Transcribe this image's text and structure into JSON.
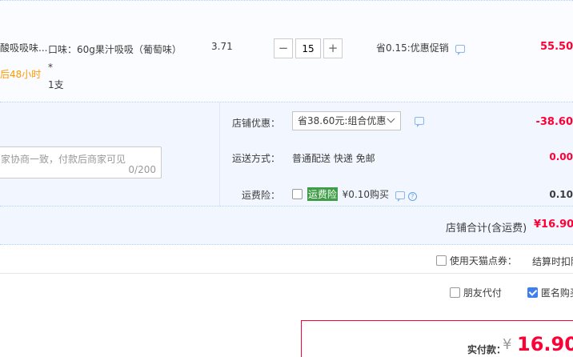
{
  "item": {
    "title": "酸吸吸味...",
    "promise": "后48小时",
    "sku_line1": "口味：60g果汁吸吸（葡萄味）*",
    "sku_line2": "1支",
    "price": "3.71",
    "qty_minus": "−",
    "qty_value": "15",
    "qty_plus": "+",
    "discount": "省0.15:优惠促销",
    "subtotal": "55.50"
  },
  "store": {
    "note_placeholder": "家协商一致，付款后商家可见",
    "note_count": "0/200",
    "coupon_label": "店铺优惠：",
    "coupon_selected": "省38.60元:组合优惠",
    "coupon_amount": "-38.60",
    "shipping_label": "运送方式：",
    "shipping_value": "普通配送 快递 免邮",
    "shipping_amount": "0.00",
    "insurance_label": "运费险：",
    "insurance_tag": "运费险",
    "insurance_value": "¥0.10购买",
    "insurance_amount": "0.10",
    "total_label": "店铺合计(含运费)",
    "total_amount": "¥16.90"
  },
  "options": {
    "points_label": "使用天猫点券：",
    "points_note": "结算时扣除",
    "friend_pay_label": "朋友代付",
    "anonymous_label": "匿名购买",
    "anonymous_checked": true
  },
  "payment": {
    "label": "实付款：",
    "currency": "¥",
    "amount": "16.90"
  },
  "colors": {
    "price_red": "#ff0036",
    "promise_orange": "#ff9900",
    "section_bg": "#f2f7ff",
    "insurance_green": "#3e9d46"
  }
}
